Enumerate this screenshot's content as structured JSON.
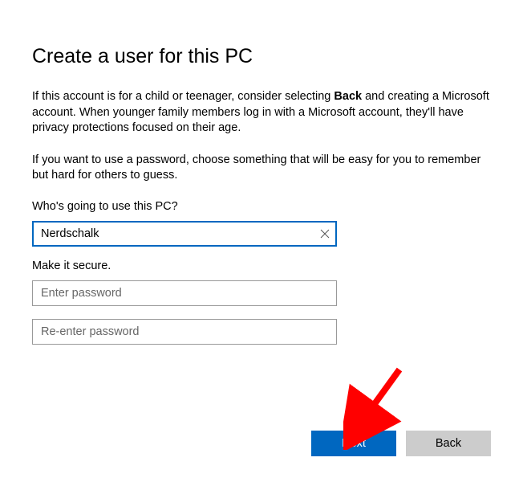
{
  "title": "Create a user for this PC",
  "paragraph1_a": "If this account is for a child or teenager, consider selecting ",
  "paragraph1_bold": "Back",
  "paragraph1_b": " and creating a Microsoft account. When younger family members log in with a Microsoft account, they'll have privacy protections focused on their age.",
  "paragraph2": "If you want to use a password, choose something that will be easy for you to remember but hard for others to guess.",
  "username_label": "Who's going to use this PC?",
  "username_value": "Nerdschalk",
  "secure_label": "Make it secure.",
  "password_placeholder": "Enter password",
  "password_confirm_placeholder": "Re-enter password",
  "next_label": "Next",
  "back_label": "Back"
}
